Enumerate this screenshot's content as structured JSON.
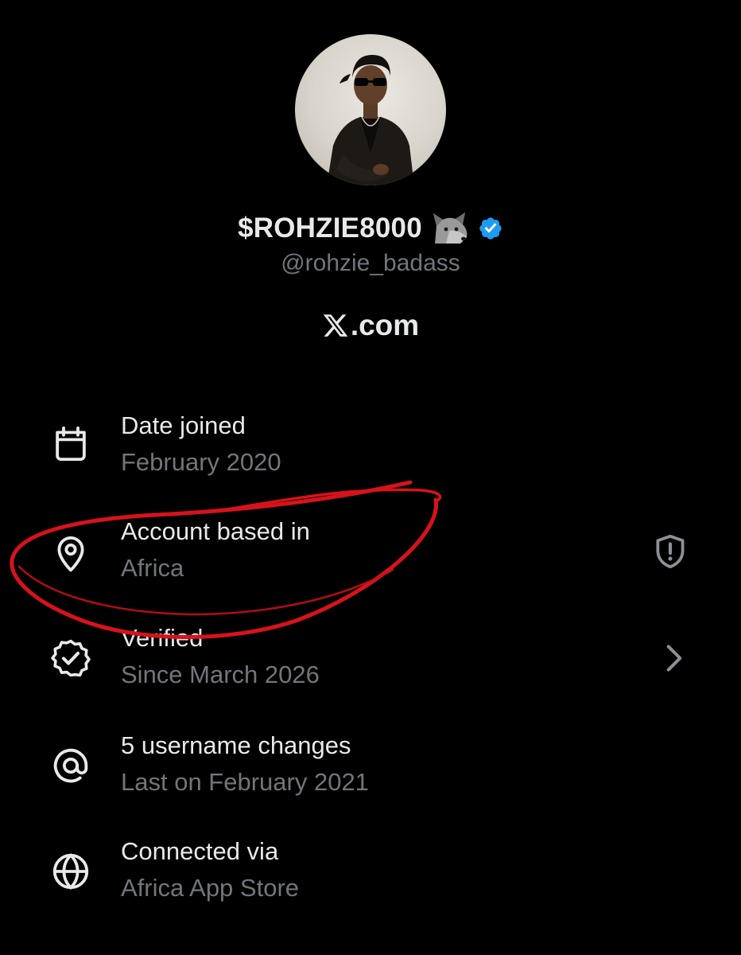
{
  "profile": {
    "display_name": "$ROHZIE8000",
    "handle": "@rohzie_badass",
    "emoji_icon": "wolf-icon",
    "badge_color": "#1d9bf0"
  },
  "site": {
    "text": ".com"
  },
  "rows": [
    {
      "title": "Date joined",
      "subtitle": "February 2020",
      "icon": "calendar-icon"
    },
    {
      "title": "Account based in",
      "subtitle": "Africa",
      "icon": "location-pin-icon",
      "trailing_icon": "shield-alert-icon"
    },
    {
      "title": "Verified",
      "subtitle": "Since March 2026",
      "icon": "verified-seal-icon",
      "trailing_icon": "chevron-right-icon"
    },
    {
      "title": "5 username changes",
      "subtitle": "Last on February 2021",
      "icon": "at-sign-icon"
    },
    {
      "title": "Connected via",
      "subtitle": "Africa App Store",
      "icon": "globe-icon"
    }
  ],
  "colors": {
    "background": "#000000",
    "primary_text": "#e7e9ea",
    "secondary_text": "#71767b",
    "annotation": "#d8121b"
  }
}
